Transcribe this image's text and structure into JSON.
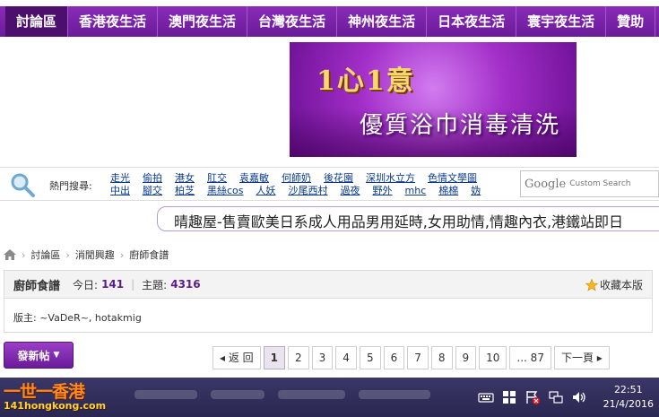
{
  "nav": {
    "tabs": [
      "討論區",
      "香港夜生活",
      "澳門夜生活",
      "台灣夜生活",
      "神州夜生活",
      "日本夜生活",
      "寰宇夜生活",
      "贊助"
    ]
  },
  "banner": {
    "brand": "1心1意",
    "tagline": "優質浴巾消毒清洗"
  },
  "search": {
    "label": "熱門搜尋:",
    "row1": [
      "走光",
      "偷拍",
      "港女",
      "肛交",
      "袁嘉敏",
      "何師奶",
      "後花園",
      "深圳水立方",
      "色情文學",
      "圖"
    ],
    "row2": [
      "中出",
      "腳交",
      "柏芝",
      "黑絲cos",
      "人妖",
      "沙尾西村",
      "過夜",
      "野外",
      "mhc",
      "棉棉",
      "妫"
    ],
    "google_logo": "Google",
    "google_placeholder": "Custom Search"
  },
  "marquee": {
    "text": "晴趣屋-售賣歐美日系成人用品男用延時,女用助情,情趣內衣,港鐵站即日"
  },
  "breadcrumb": [
    "討論區",
    "消閒興趣",
    "廚師食譜"
  ],
  "forum": {
    "name": "廚師食譜",
    "today_label": "今日:",
    "today_value": "141",
    "topics_label": "主題:",
    "topics_value": "4316",
    "favorite": "收藏本版",
    "moderators": "版主: ~VaDeR~, hotakmig"
  },
  "actions": {
    "new_post": "發新帖",
    "new_post_caret": "▼"
  },
  "pager": {
    "back": "◂ 返 回",
    "pages": [
      "1",
      "2",
      "3",
      "4",
      "5",
      "6",
      "7",
      "8",
      "9",
      "10"
    ],
    "last": "... 87",
    "next": "下一頁 ▸",
    "current": "1"
  },
  "taskbar": {
    "logo_cn": "一世一香港",
    "logo_url": "141hongkong.com",
    "time": "22:51",
    "date": "21/4/2016"
  },
  "colors": {
    "nav_purple": "#6a1b9a",
    "link_blue": "#0b3a8c",
    "count_purple": "#5b1e86"
  }
}
